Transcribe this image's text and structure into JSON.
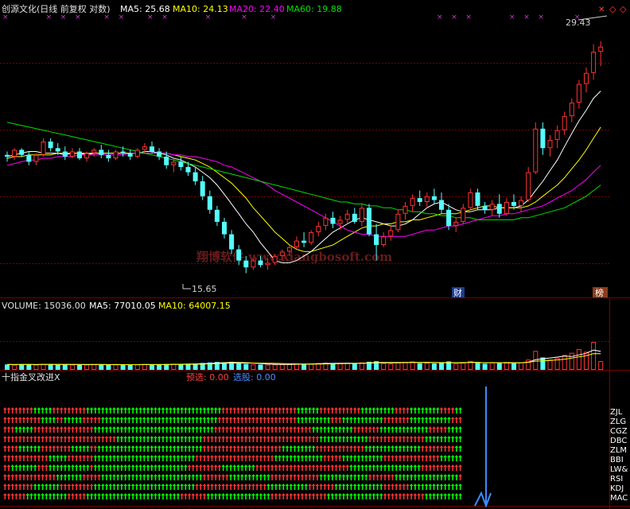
{
  "header": {
    "title": "创源文化(日线 前复权 对数)",
    "ma5": "MA5: 25.68",
    "ma10": "MA10: 24.13",
    "ma20": "MA20: 22.40",
    "ma60": "MA60: 19.88"
  },
  "annotations": {
    "high": "29.43",
    "low": "15.65",
    "cai": "财",
    "bang": "榜",
    "watermark": "翔博软件 www.xiangbosoft.com"
  },
  "volume_header": {
    "volume": "VOLUME: 15036.00",
    "ma5": "MA5: 77010.05",
    "ma10": "MA10: 64007.15"
  },
  "indicator_header": {
    "name": "十指金叉改进X",
    "yuxuan": "预选: 0.00",
    "xuangu": "选股: 0.00"
  },
  "indicator_rows": [
    "ZJL",
    "ZLG",
    "CGZ",
    "DBC",
    "ZLM",
    "BBI",
    "LW&",
    "RSI",
    "KDJ",
    "MAC"
  ],
  "colors": {
    "up": "#ff3232",
    "down": "#54ffff",
    "ma5": "#ffffff",
    "ma10": "#ffff00",
    "ma20": "#ff00ff",
    "ma60": "#00e000",
    "arrow_green": "#00ff00",
    "arrow_red": "#ff3232",
    "signal_blue": "#3c8cff",
    "grid": "#7a0000"
  },
  "chart_data": [
    {
      "type": "candlestick",
      "title": "创源文化(日线 前复权 对数)",
      "yscale": "log",
      "ylim": [
        15.2,
        30.2
      ],
      "marked_high": 29.43,
      "marked_low": 15.65,
      "candles": [
        [
          21.6,
          21.8,
          21.2,
          21.5
        ],
        [
          21.5,
          22.0,
          21.3,
          21.9
        ],
        [
          21.9,
          22.0,
          21.5,
          21.6
        ],
        [
          21.6,
          21.8,
          21.0,
          21.2
        ],
        [
          21.2,
          21.7,
          21.0,
          21.6
        ],
        [
          21.6,
          22.6,
          21.5,
          22.4
        ],
        [
          22.4,
          22.6,
          21.8,
          22.0
        ],
        [
          22.0,
          22.3,
          21.6,
          21.8
        ],
        [
          21.8,
          22.1,
          21.3,
          21.5
        ],
        [
          21.5,
          22.0,
          21.4,
          21.8
        ],
        [
          21.8,
          22.0,
          21.3,
          21.4
        ],
        [
          21.4,
          21.8,
          21.2,
          21.7
        ],
        [
          21.7,
          22.0,
          21.5,
          21.9
        ],
        [
          21.9,
          22.2,
          21.4,
          21.6
        ],
        [
          21.6,
          21.9,
          21.2,
          21.4
        ],
        [
          21.4,
          21.9,
          21.3,
          21.8
        ],
        [
          21.8,
          22.1,
          21.5,
          21.7
        ],
        [
          21.7,
          21.9,
          21.3,
          21.5
        ],
        [
          21.5,
          22.0,
          21.4,
          21.9
        ],
        [
          21.9,
          22.3,
          21.7,
          22.1
        ],
        [
          22.1,
          22.4,
          21.7,
          21.8
        ],
        [
          21.8,
          22.0,
          21.3,
          21.5
        ],
        [
          21.5,
          21.8,
          20.8,
          21.0
        ],
        [
          21.0,
          21.4,
          20.6,
          21.2
        ],
        [
          21.2,
          21.5,
          20.7,
          20.9
        ],
        [
          20.9,
          21.2,
          20.4,
          20.6
        ],
        [
          20.6,
          20.9,
          19.9,
          20.1
        ],
        [
          20.1,
          20.4,
          19.1,
          19.3
        ],
        [
          19.3,
          19.6,
          18.4,
          18.6
        ],
        [
          18.6,
          18.8,
          17.8,
          18.0
        ],
        [
          18.0,
          18.2,
          17.2,
          17.4
        ],
        [
          17.4,
          17.6,
          16.5,
          16.7
        ],
        [
          16.7,
          16.9,
          16.0,
          16.2
        ],
        [
          16.2,
          16.4,
          15.65,
          15.9
        ],
        [
          15.9,
          16.3,
          15.8,
          16.2
        ],
        [
          16.2,
          16.4,
          15.9,
          16.0
        ],
        [
          16.0,
          16.3,
          15.8,
          16.1
        ],
        [
          16.1,
          16.5,
          16.0,
          16.4
        ],
        [
          16.4,
          16.7,
          16.2,
          16.6
        ],
        [
          16.6,
          16.9,
          16.4,
          16.8
        ],
        [
          16.8,
          17.3,
          16.7,
          17.1
        ],
        [
          17.1,
          17.5,
          16.8,
          17.0
        ],
        [
          17.0,
          17.6,
          16.9,
          17.5
        ],
        [
          17.5,
          18.0,
          17.3,
          17.8
        ],
        [
          17.8,
          18.4,
          17.6,
          18.2
        ],
        [
          18.2,
          18.5,
          17.7,
          17.9
        ],
        [
          17.9,
          18.3,
          17.6,
          18.1
        ],
        [
          18.1,
          18.6,
          17.9,
          18.4
        ],
        [
          18.4,
          18.7,
          17.9,
          18.0
        ],
        [
          18.0,
          18.9,
          17.8,
          18.7
        ],
        [
          18.7,
          18.9,
          17.3,
          17.4
        ],
        [
          17.4,
          17.9,
          16.2,
          16.9
        ],
        [
          16.9,
          17.5,
          16.8,
          17.3
        ],
        [
          17.3,
          17.8,
          17.1,
          17.6
        ],
        [
          17.6,
          18.6,
          17.5,
          18.4
        ],
        [
          18.4,
          19.0,
          18.1,
          18.8
        ],
        [
          18.8,
          19.4,
          18.5,
          19.2
        ],
        [
          19.2,
          19.6,
          18.8,
          19.0
        ],
        [
          19.0,
          19.5,
          18.7,
          19.3
        ],
        [
          19.3,
          19.7,
          18.9,
          19.1
        ],
        [
          19.1,
          19.5,
          18.4,
          18.6
        ],
        [
          18.6,
          18.9,
          17.6,
          17.8
        ],
        [
          17.8,
          18.2,
          17.5,
          18.0
        ],
        [
          18.0,
          18.9,
          17.9,
          18.7
        ],
        [
          18.7,
          19.7,
          18.6,
          19.5
        ],
        [
          19.5,
          19.7,
          18.6,
          18.8
        ],
        [
          18.8,
          19.0,
          18.4,
          18.6
        ],
        [
          18.6,
          19.1,
          18.3,
          18.9
        ],
        [
          18.9,
          19.4,
          18.2,
          18.4
        ],
        [
          18.4,
          19.2,
          18.3,
          19.0
        ],
        [
          19.0,
          19.4,
          18.6,
          18.8
        ],
        [
          18.8,
          19.3,
          18.5,
          19.1
        ],
        [
          19.1,
          20.9,
          19.0,
          20.6
        ],
        [
          20.6,
          23.6,
          20.5,
          23.2
        ],
        [
          23.2,
          23.6,
          21.6,
          22.0
        ],
        [
          22.0,
          22.8,
          21.5,
          22.5
        ],
        [
          22.5,
          23.4,
          22.0,
          23.1
        ],
        [
          23.1,
          24.3,
          22.8,
          24.0
        ],
        [
          24.0,
          25.2,
          23.6,
          24.9
        ],
        [
          24.9,
          26.5,
          24.5,
          26.2
        ],
        [
          26.2,
          27.4,
          25.6,
          27.0
        ],
        [
          27.0,
          29.2,
          26.5,
          28.6
        ],
        [
          28.6,
          29.43,
          27.5,
          29.0
        ]
      ],
      "ma": {
        "MA5": [
          21.5,
          21.6,
          21.7,
          21.8,
          21.8,
          21.7,
          21.7,
          21.7,
          21.6,
          21.7,
          21.7,
          21.6,
          21.7,
          21.7,
          21.7,
          21.7,
          21.7,
          21.7,
          21.7,
          21.8,
          21.8,
          21.7,
          21.6,
          21.4,
          21.3,
          21.1,
          20.9,
          20.6,
          20.3,
          19.9,
          19.4,
          18.9,
          18.4,
          17.9,
          17.5,
          17.0,
          16.6,
          16.2,
          16.1,
          16.1,
          16.2,
          16.4,
          16.6,
          16.9,
          17.2,
          17.5,
          17.7,
          17.9,
          18.1,
          18.2,
          18.1,
          18.0,
          17.9,
          17.8,
          17.8,
          17.9,
          18.1,
          18.4,
          18.7,
          18.9,
          19.0,
          18.8,
          18.6,
          18.5,
          18.5,
          18.6,
          18.6,
          18.6,
          18.7,
          18.7,
          18.7,
          18.8,
          19.1,
          19.6,
          20.1,
          20.7,
          21.3,
          22.1,
          22.9,
          23.7,
          24.4,
          25.2,
          25.7
        ],
        "MA10": [
          21.4,
          21.5,
          21.5,
          21.6,
          21.6,
          21.6,
          21.6,
          21.7,
          21.7,
          21.7,
          21.7,
          21.7,
          21.7,
          21.7,
          21.7,
          21.7,
          21.7,
          21.7,
          21.7,
          21.7,
          21.7,
          21.7,
          21.7,
          21.6,
          21.5,
          21.4,
          21.3,
          21.1,
          20.9,
          20.6,
          20.3,
          20.0,
          19.6,
          19.2,
          18.7,
          18.3,
          17.9,
          17.5,
          17.2,
          16.9,
          16.7,
          16.6,
          16.6,
          16.7,
          16.8,
          16.9,
          17.1,
          17.3,
          17.5,
          17.7,
          17.8,
          17.8,
          17.9,
          17.9,
          18.0,
          18.0,
          18.1,
          18.1,
          18.2,
          18.3,
          18.4,
          18.4,
          18.4,
          18.5,
          18.6,
          18.7,
          18.8,
          18.8,
          18.7,
          18.7,
          18.7,
          18.7,
          18.8,
          19.0,
          19.3,
          19.6,
          19.9,
          20.3,
          20.8,
          21.3,
          21.9,
          22.6,
          23.3
        ],
        "MA20": [
          21.0,
          21.1,
          21.2,
          21.3,
          21.3,
          21.4,
          21.4,
          21.5,
          21.5,
          21.5,
          21.6,
          21.6,
          21.6,
          21.6,
          21.6,
          21.6,
          21.6,
          21.7,
          21.7,
          21.7,
          21.7,
          21.7,
          21.7,
          21.6,
          21.6,
          21.5,
          21.5,
          21.4,
          21.3,
          21.2,
          21.0,
          20.9,
          20.7,
          20.5,
          20.3,
          20.1,
          19.9,
          19.6,
          19.4,
          19.2,
          19.0,
          18.8,
          18.6,
          18.4,
          18.2,
          18.0,
          17.8,
          17.6,
          17.5,
          17.4,
          17.4,
          17.3,
          17.3,
          17.3,
          17.3,
          17.3,
          17.4,
          17.5,
          17.6,
          17.6,
          17.7,
          17.8,
          17.8,
          17.9,
          18.0,
          18.1,
          18.2,
          18.3,
          18.3,
          18.4,
          18.4,
          18.5,
          18.6,
          18.7,
          18.8,
          19.0,
          19.2,
          19.4,
          19.6,
          19.9,
          20.2,
          20.6,
          21.0
        ],
        "MA60": [
          23.6,
          23.5,
          23.4,
          23.3,
          23.2,
          23.1,
          23.0,
          22.9,
          22.8,
          22.7,
          22.6,
          22.5,
          22.4,
          22.3,
          22.2,
          22.1,
          22.0,
          21.9,
          21.8,
          21.7,
          21.6,
          21.5,
          21.4,
          21.3,
          21.2,
          21.1,
          21.0,
          20.9,
          20.8,
          20.7,
          20.6,
          20.5,
          20.4,
          20.3,
          20.2,
          20.1,
          20.0,
          19.9,
          19.8,
          19.7,
          19.6,
          19.5,
          19.4,
          19.3,
          19.2,
          19.1,
          19.0,
          19.0,
          18.9,
          18.9,
          18.8,
          18.8,
          18.7,
          18.7,
          18.6,
          18.6,
          18.5,
          18.5,
          18.4,
          18.4,
          18.3,
          18.3,
          18.2,
          18.2,
          18.2,
          18.1,
          18.1,
          18.1,
          18.1,
          18.1,
          18.1,
          18.2,
          18.2,
          18.3,
          18.4,
          18.5,
          18.6,
          18.7,
          18.9,
          19.1,
          19.3,
          19.6,
          19.9
        ]
      }
    },
    {
      "type": "bar",
      "title": "VOLUME",
      "ylim": [
        0,
        100000
      ],
      "values": [
        9200,
        8800,
        9500,
        9100,
        8900,
        10200,
        9400,
        8700,
        9300,
        9000,
        8600,
        9100,
        9400,
        8800,
        8500,
        9200,
        9000,
        8700,
        9300,
        9600,
        8900,
        8800,
        9900,
        10400,
        9800,
        10100,
        10800,
        11800,
        12600,
        13500,
        12900,
        13800,
        11200,
        10300,
        9700,
        9100,
        8900,
        9300,
        9600,
        9900,
        10500,
        9800,
        10700,
        11500,
        12300,
        10900,
        11100,
        11800,
        10600,
        12600,
        13900,
        14800,
        11600,
        10800,
        12900,
        13600,
        14400,
        11300,
        12100,
        11000,
        11900,
        14500,
        10700,
        12400,
        15300,
        11800,
        10400,
        12600,
        11500,
        13200,
        11000,
        12800,
        17600,
        32500,
        21300,
        17800,
        20400,
        25600,
        29300,
        35800,
        31200,
        48100,
        15036
      ]
    },
    {
      "type": "table",
      "title": "十指金叉改进X",
      "rows": [
        "ZJL",
        "ZLG",
        "CGZ",
        "DBC",
        "ZLM",
        "BBI",
        "LW&",
        "RSI",
        "KDJ",
        "MAC"
      ],
      "legend": {
        "G": "green up-arrow",
        "R": "red up-arrow"
      },
      "signal_column": 83,
      "cells": [
        "RRRRRRRRRRRRRRRRRRRRRRRRRRRRRRRRRRRRRRRRRRRRRRRRRRRRRRRRRRRRRRRRRRRRRRRRRRRRRRRRRRRRRRRRRRRRRRRRRRRRRRRRRRRRRRRRRRRRRRRRRR",
        "RRRRRRRRRRRRRRRRRRRRRRRRRRRRRRRRRRRRRRRRRRRRRRRRRRRRRRRRRRRRRRRRRRRRRRRRRRRRRRRRRRRRRRRRRRRRRRRRRRRRRRRRRRRRRRRRRRRRRRRRRR",
        "RRRRRRRRRRRRRRRRRRRRRRRRRRRRRRRRRRRRRRRRRRRRRRRRRRRRRRRRRRRRRRRRRRRRRRRRRRRRRRRRRRRRRRRRRRRRRRRRRRRRRRRRRRRRRRRRRRRRRRRRRR",
        "RRRRRRRRRRRRRRRRRRRRRRRRRRRRRRRRRRRRRRRRRRRRRRRRRRRRRRRRRRRRRRRRRRRRRRRRRRRRRRRRRRRRRRRRRRRRRRRRRRRRRRRRRRRRRRRRRRRRRRRRRR",
        "RRRRRRRRRRRRRRRRRRRRRRRRRRRRRRRRRRRRRRRRRRRRRRRRRRRRRRRRRRRRRRRRRRRRRRRRRRRRRRRRRRRRRRRRRRRRRRRRRRRRRRRRRRRRRRRRRRRRRRRRRR",
        "RRRRRRRRRRRRRRRRRRRRRRRRRRRRRRRRRRRRRRRRRRRRRRRRRRRRRRRRRRRRRRRRRRRRRRRRRRRRRRRRRRRRRRRRRRRRRRRRRRRRRRRRRRRRRRRRRRRRRRRRRR",
        "RRRRRRRRRRRRRRRRRRRRRRRRRRRRRRRRRRRRRRRRRRRRRRRRRRRRRRRRRRRRRRRRRRRRRRRRRRRRRRRRRRRRRRRRRRRRRRRRRRRRRRRRRRRRRRRRRRRRRRRRRR",
        "RRRRRRRRRRRRRRRRRRRRRRRRRRRRRRRRRRRRRRRRRRRRRRRRRRRRRRRRRRRRRRRRRRRRRRRRRRRRRRRRRRRRRRRRRRRRRRRRRRRRRRRRRRRRRRRRRRRRRRRRRR",
        "RRRRRRRRRRRRRRRRRRRRRRRRRRRRRRRRRRRRRRRRRRRRRRRRRRRRRRRRRRRRRRRRRRRRRRRRRRRRRRRRRRRRRRRRRRRRRRRRRRRRRRRRRRRRRRRRRRRRRRRRRR",
        "RRRRRRRRRRRRRRRRRRRRRRRRRRRRRRRRRRRRRRRRRRRRRRRRRRRRRRRRRRRRRRRRRRRRRRRRRRRRRRRRRRRRRRRRRRRRRRRRRRRRRRRRRRRRRRRRRRRRRRRRRR"
      ]
    }
  ]
}
